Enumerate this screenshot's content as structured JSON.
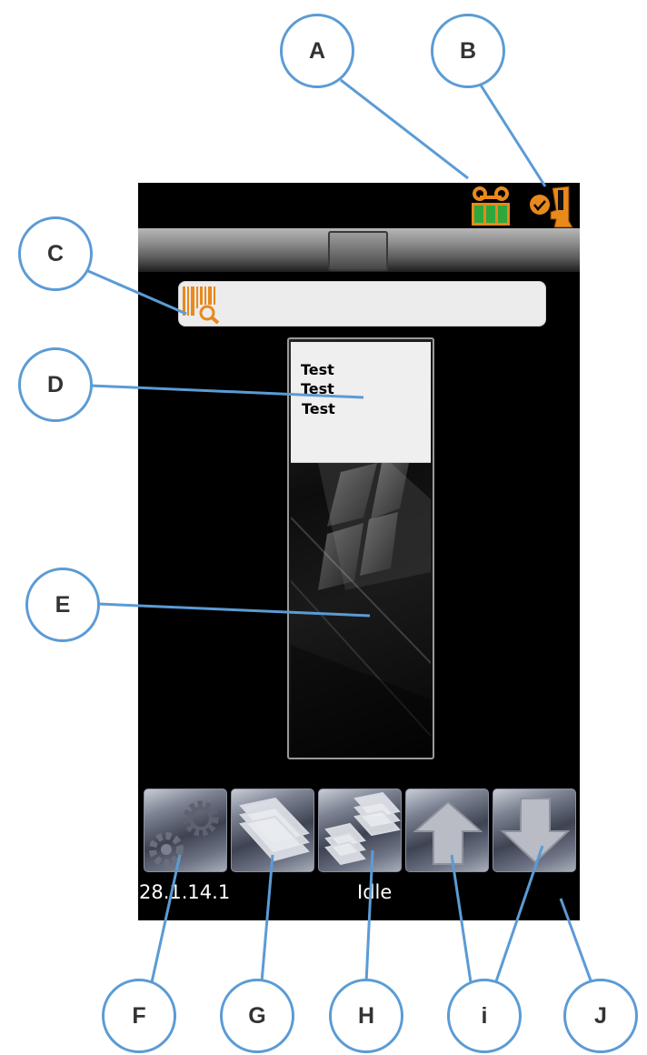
{
  "status_icons": [
    {
      "icon": "reagent-cassette-icon",
      "color": "#e8891c",
      "level_color": "#2ea83a"
    },
    {
      "icon": "instrument-ready-icon",
      "color": "#e8891c"
    }
  ],
  "barcode_field": {
    "icon": "barcode-search-icon",
    "value": ""
  },
  "slide": {
    "label_lines": [
      "Test",
      "Test",
      "Test"
    ]
  },
  "toolbar": [
    {
      "name": "settings-button",
      "icon": "gears-icon"
    },
    {
      "name": "slides-button",
      "icon": "slide-stack-icon"
    },
    {
      "name": "slide-rack-button",
      "icon": "slide-rack-icon"
    },
    {
      "name": "scroll-up-button",
      "icon": "arrow-up-icon"
    },
    {
      "name": "scroll-down-button",
      "icon": "arrow-down-icon"
    }
  ],
  "status_bar": {
    "version": "28.1.14.1",
    "state": "Idle"
  },
  "callouts": [
    "A",
    "B",
    "C",
    "D",
    "E",
    "F",
    "G",
    "H",
    "i",
    "J"
  ],
  "colors": {
    "callout": "#5b9bd5",
    "screen": "#000000",
    "accent": "#e8891c"
  }
}
